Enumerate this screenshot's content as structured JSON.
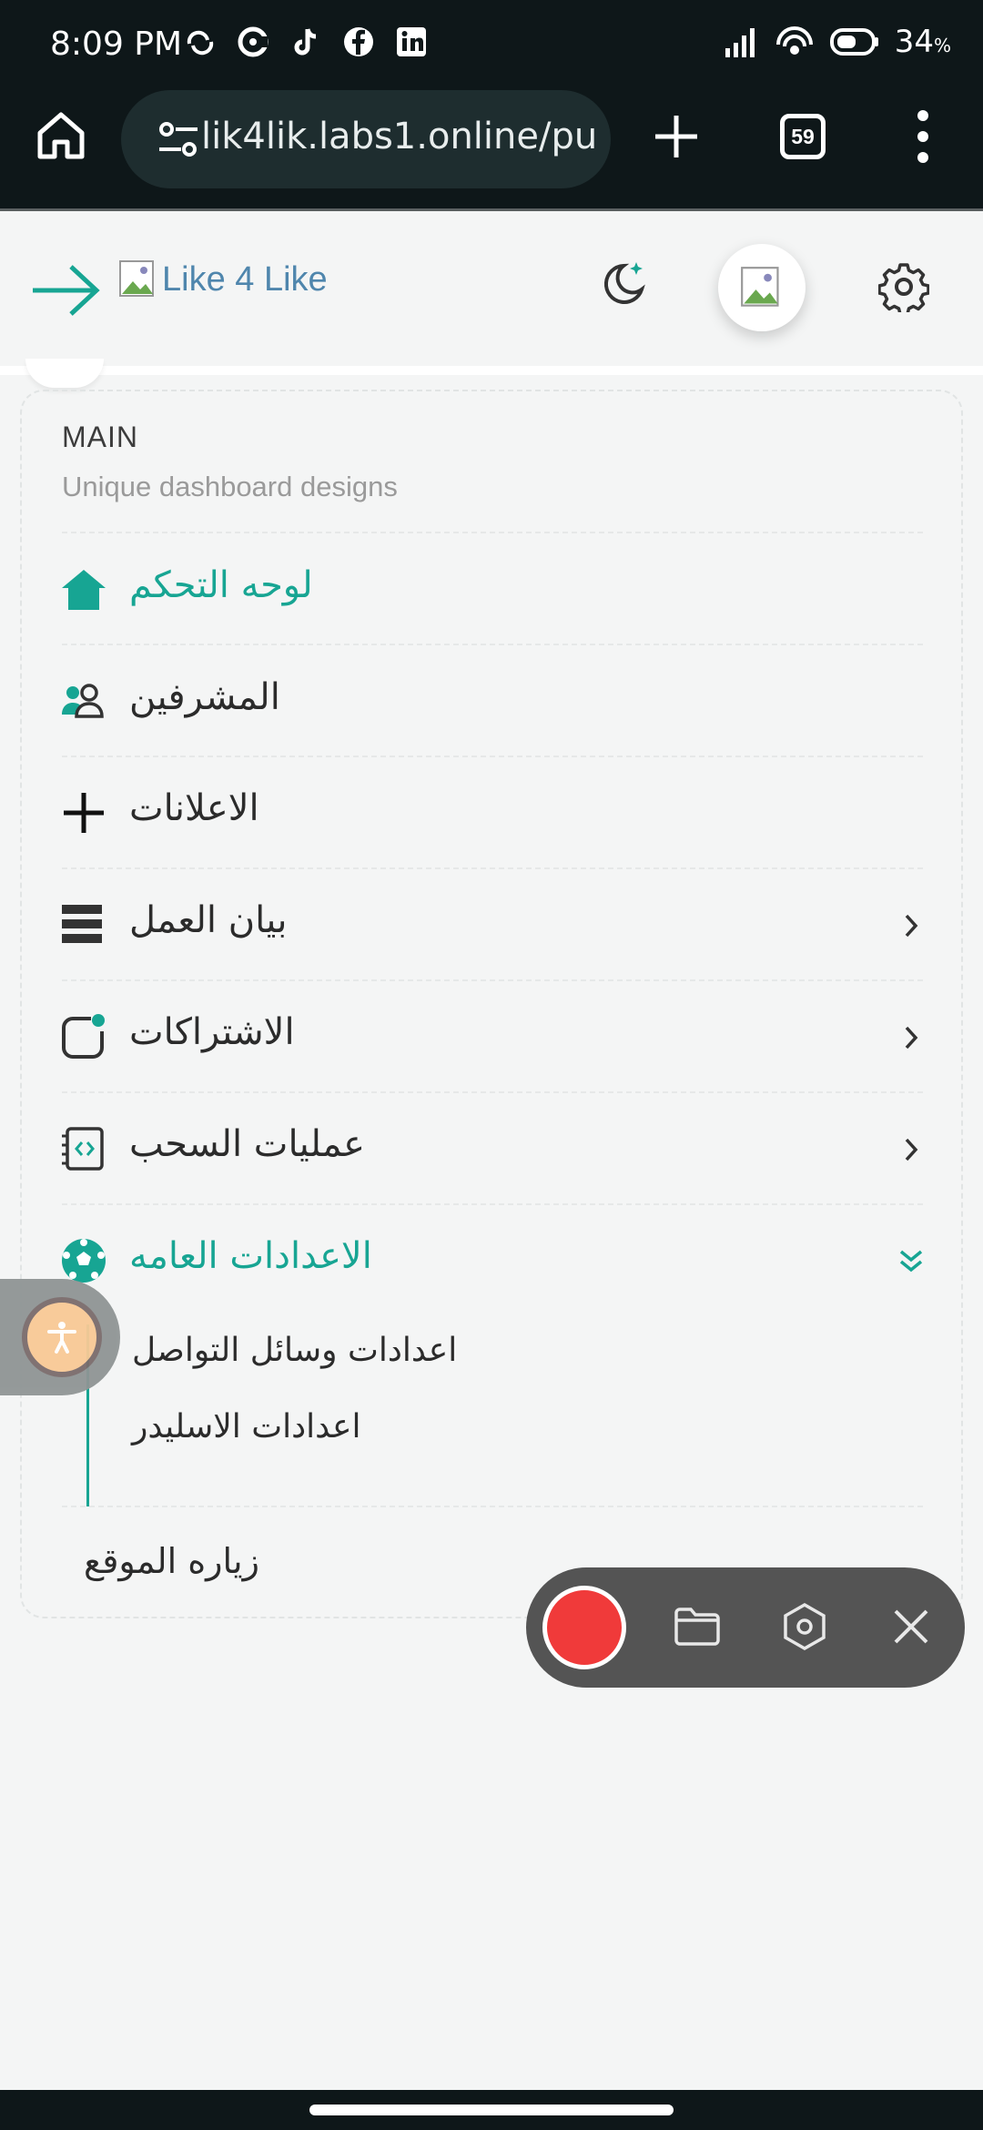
{
  "status_bar": {
    "time": "8:09 PM",
    "battery_percent": "34",
    "battery_unit": "%"
  },
  "browser": {
    "url": "lik4lik.labs1.online/pu",
    "tab_count": "59"
  },
  "header": {
    "logo_alt": "Like 4 Like"
  },
  "menu": {
    "heading": "MAIN",
    "subheading": "Unique dashboard designs",
    "items": [
      {
        "label": "لوحه التحكم",
        "icon": "home-icon"
      },
      {
        "label": "المشرفين",
        "icon": "users-icon"
      },
      {
        "label": "الاعلانات",
        "icon": "plus-icon"
      },
      {
        "label": "بيان العمل",
        "icon": "stack-icon"
      },
      {
        "label": "الاشتراكات",
        "icon": "subscription-icon"
      },
      {
        "label": "عمليات السحب",
        "icon": "code-file-icon"
      },
      {
        "label": "الاعدادات العامه",
        "icon": "soccer-ball-icon"
      }
    ],
    "subitems": [
      "اعدادات وسائل التواصل",
      "اعدادات الاسليدر"
    ],
    "visit_site": "زياره الموقع"
  },
  "colors": {
    "accent": "#17a593",
    "chrome": "#0e1719",
    "recorder": "#545454",
    "record_red": "#f03a3a"
  }
}
